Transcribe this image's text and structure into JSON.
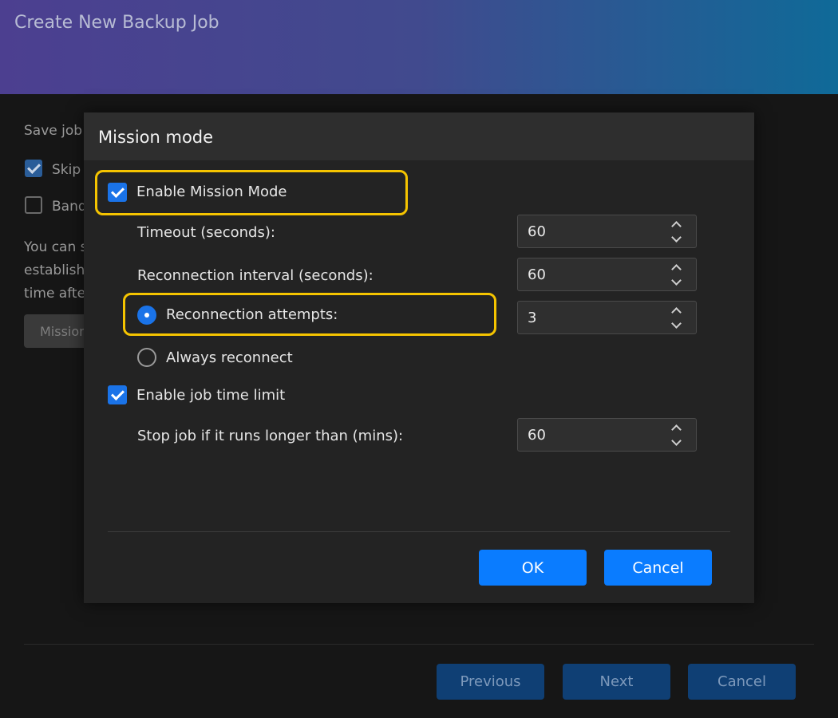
{
  "window": {
    "title": "Create New Backup Job"
  },
  "background": {
    "save_label": "Save job",
    "skip_label": "Skip",
    "skip_checked": true,
    "band_label": "Band",
    "band_checked": false,
    "desc_line1": "You can s",
    "desc_line2": "establish",
    "desc_line3": "time afte",
    "mission_button": "Mission",
    "footer": {
      "previous": "Previous",
      "next": "Next",
      "cancel": "Cancel"
    }
  },
  "dialog": {
    "title": "Mission mode",
    "enable_mission_mode": {
      "label": "Enable Mission Mode",
      "checked": true
    },
    "timeout": {
      "label": "Timeout (seconds):",
      "value": "60"
    },
    "reconnect_interval": {
      "label": "Reconnection interval (seconds):",
      "value": "60"
    },
    "reconnect_attempts": {
      "label": "Reconnection attempts:",
      "value": "3",
      "selected": true
    },
    "always_reconnect": {
      "label": "Always reconnect",
      "selected": false
    },
    "enable_time_limit": {
      "label": "Enable job time limit",
      "checked": true
    },
    "stop_job": {
      "label": "Stop job if it runs longer than (mins):",
      "value": "60"
    },
    "ok_label": "OK",
    "cancel_label": "Cancel"
  },
  "colors": {
    "accent": "#0a7cff",
    "highlight": "#f5c400",
    "dialog_bg": "#232323",
    "header_gradient_start": "#4c3f90",
    "header_gradient_end": "#0f6a98"
  },
  "icons": {
    "checkbox_checked": "checkmark-icon",
    "radio_selected": "radio-dot-icon",
    "spin_up": "chevron-up-icon",
    "spin_down": "chevron-down-icon"
  }
}
